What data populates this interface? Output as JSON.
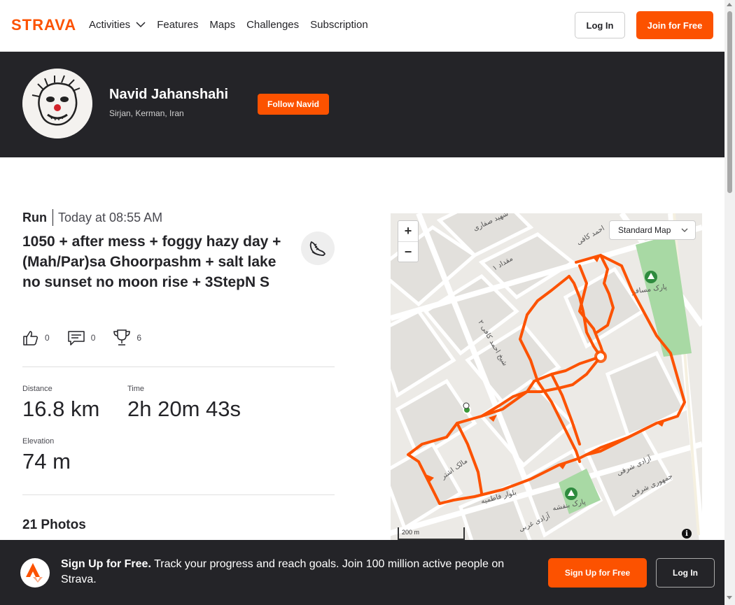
{
  "nav": {
    "logo": "STRAVA",
    "items": [
      {
        "label": "Activities"
      },
      {
        "label": "Features"
      },
      {
        "label": "Maps"
      },
      {
        "label": "Challenges"
      },
      {
        "label": "Subscription"
      }
    ],
    "login_label": "Log In",
    "join_label": "Join for Free"
  },
  "athlete": {
    "name": "Navid Jahanshahi",
    "location": "Sirjan, Kerman, Iran",
    "follow_label": "Follow Navid"
  },
  "activity": {
    "type": "Run",
    "date": "Today at 08:55 AM",
    "title": "1050 + after mess + foggy hazy day + (Mah/Par)sa Ghoorpashm + salt lake no sunset no moon rise + 3StepN S",
    "kudos": "0",
    "comments": "0",
    "achievements": "6",
    "stats": {
      "distance_label": "Distance",
      "distance_value": "16.8 km",
      "time_label": "Time",
      "time_value": "2h 20m 43s",
      "elevation_label": "Elevation",
      "elevation_value": "74 m"
    },
    "photos_title": "21 Photos"
  },
  "map": {
    "zoom_in": "+",
    "zoom_out": "−",
    "style_label": "Standard Map",
    "scale_label": "200 m",
    "info": "i",
    "route_color": "#fc5200",
    "park_color": "#a8d9a4",
    "labels": {
      "park1": "پارک مسافر",
      "park2": "پارک بنفشه",
      "street1": "بلوار فاطمیه",
      "street2": "آزادی شرقی",
      "street3": "جمهوری شرقی",
      "street4": "آزادی غربی",
      "street5": "مالک اشتر",
      "street6": "شیخ احمد کافی ۲",
      "street7": "مقداد ۱",
      "street8": "شهید صفاری",
      "street9": "احمد کافی"
    }
  },
  "banner": {
    "bold": "Sign Up for Free.",
    "text": "Track your progress and reach goals. Join 100 million active people on Strava.",
    "signup_label": "Sign Up for Free",
    "login_label": "Log In"
  },
  "colors": {
    "brand": "#fc5200",
    "dark": "#242428"
  }
}
